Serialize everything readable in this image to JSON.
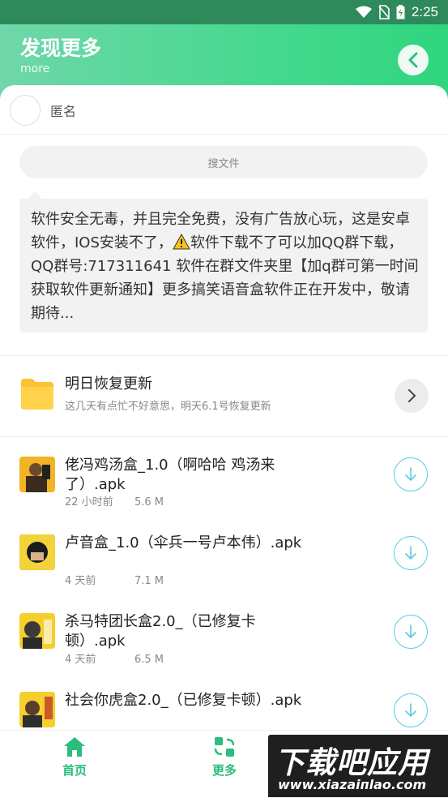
{
  "status_bar": {
    "time": "2:25"
  },
  "header": {
    "title": "发现更多",
    "subtitle": "more"
  },
  "user": {
    "name": "匿名"
  },
  "search": {
    "placeholder": "搜文件"
  },
  "notice": {
    "text_before_icon": "软件安全无毒，并且完全免费，没有广告放心玩，这是安卓软件，IOS安装不了，",
    "text_after_icon": "软件下载不了可以加QQ群下载，QQ群号:717311641 软件在群文件夹里【加q群可第一时间获取软件更新通知】更多搞笑语音盒软件正在开发中，敬请期待..."
  },
  "folder": {
    "title": "明日恢复更新",
    "subtitle": "这几天有点忙不好意思，明天6.1号恢复更新"
  },
  "files": [
    {
      "name": "佬冯鸡汤盒_1.0（啊哈哈 鸡汤来了）.apk",
      "time": "22 小时前",
      "size": "5.6 M"
    },
    {
      "name": "卢音盒_1.0（伞兵一号卢本伟）.apk",
      "time": "4 天前",
      "size": "7.1 M"
    },
    {
      "name": "杀马特团长盒2.0_（已修复卡顿）.apk",
      "time": "4 天前",
      "size": "6.5 M"
    },
    {
      "name": "社会你虎盒2.0_（已修复卡顿）.apk",
      "time": "",
      "size": ""
    }
  ],
  "nav": [
    {
      "label": "首页",
      "icon": "home-icon"
    },
    {
      "label": "更多",
      "icon": "switch-icon"
    }
  ],
  "watermark": {
    "big": "下载吧应用",
    "small": "www.xiazaiпlao.com"
  },
  "colors": {
    "accent": "#2bbd7e",
    "download": "#5bc8e8"
  }
}
